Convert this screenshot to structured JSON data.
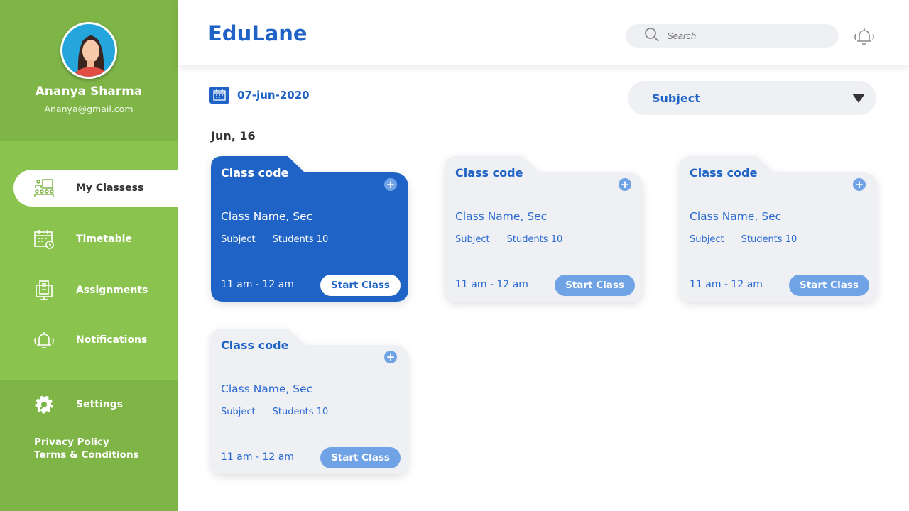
{
  "user": {
    "name": "Ananya Sharma",
    "email": "Ananya@gmail.com"
  },
  "nav": [
    {
      "label": "My Classess",
      "icon": "classroom-icon",
      "active": true
    },
    {
      "label": "Timetable",
      "icon": "calendar-clock-icon"
    },
    {
      "label": "Assignments",
      "icon": "assignment-icon"
    },
    {
      "label": "Notifications",
      "icon": "bell-icon"
    },
    {
      "label": "Settings",
      "icon": "gear-icon"
    }
  ],
  "legal": {
    "privacy": "Privacy Policy",
    "terms": "Terms & Conditions"
  },
  "header": {
    "title": "EduLane",
    "search_placeholder": "Search"
  },
  "filters": {
    "date": "07-jun-2020",
    "subject": "Subject"
  },
  "day_label": "Jun, 16",
  "cards": [
    {
      "code": "Class code",
      "name": "Class Name, Sec",
      "subject": "Subject",
      "students": "Students 10",
      "time": "11 am - 12 am",
      "button": "Start Class"
    },
    {
      "code": "Class code",
      "name": "Class Name, Sec",
      "subject": "Subject",
      "students": "Students 10",
      "time": "11 am - 12 am",
      "button": "Start Class"
    },
    {
      "code": "Class code",
      "name": "Class Name, Sec",
      "subject": "Subject",
      "students": "Students 10",
      "time": "11 am - 12 am",
      "button": "Start Class"
    },
    {
      "code": "Class code",
      "name": "Class Name, Sec",
      "subject": "Subject",
      "students": "Students 10",
      "time": "11 am - 12 am",
      "button": "Start Class"
    }
  ],
  "colors": {
    "primary": "#1f63c6",
    "sidebar": "#8bc34f",
    "sidebar_dark": "#7fb447",
    "card_light": "#eef0f4",
    "button_light": "#6fa3e6"
  }
}
